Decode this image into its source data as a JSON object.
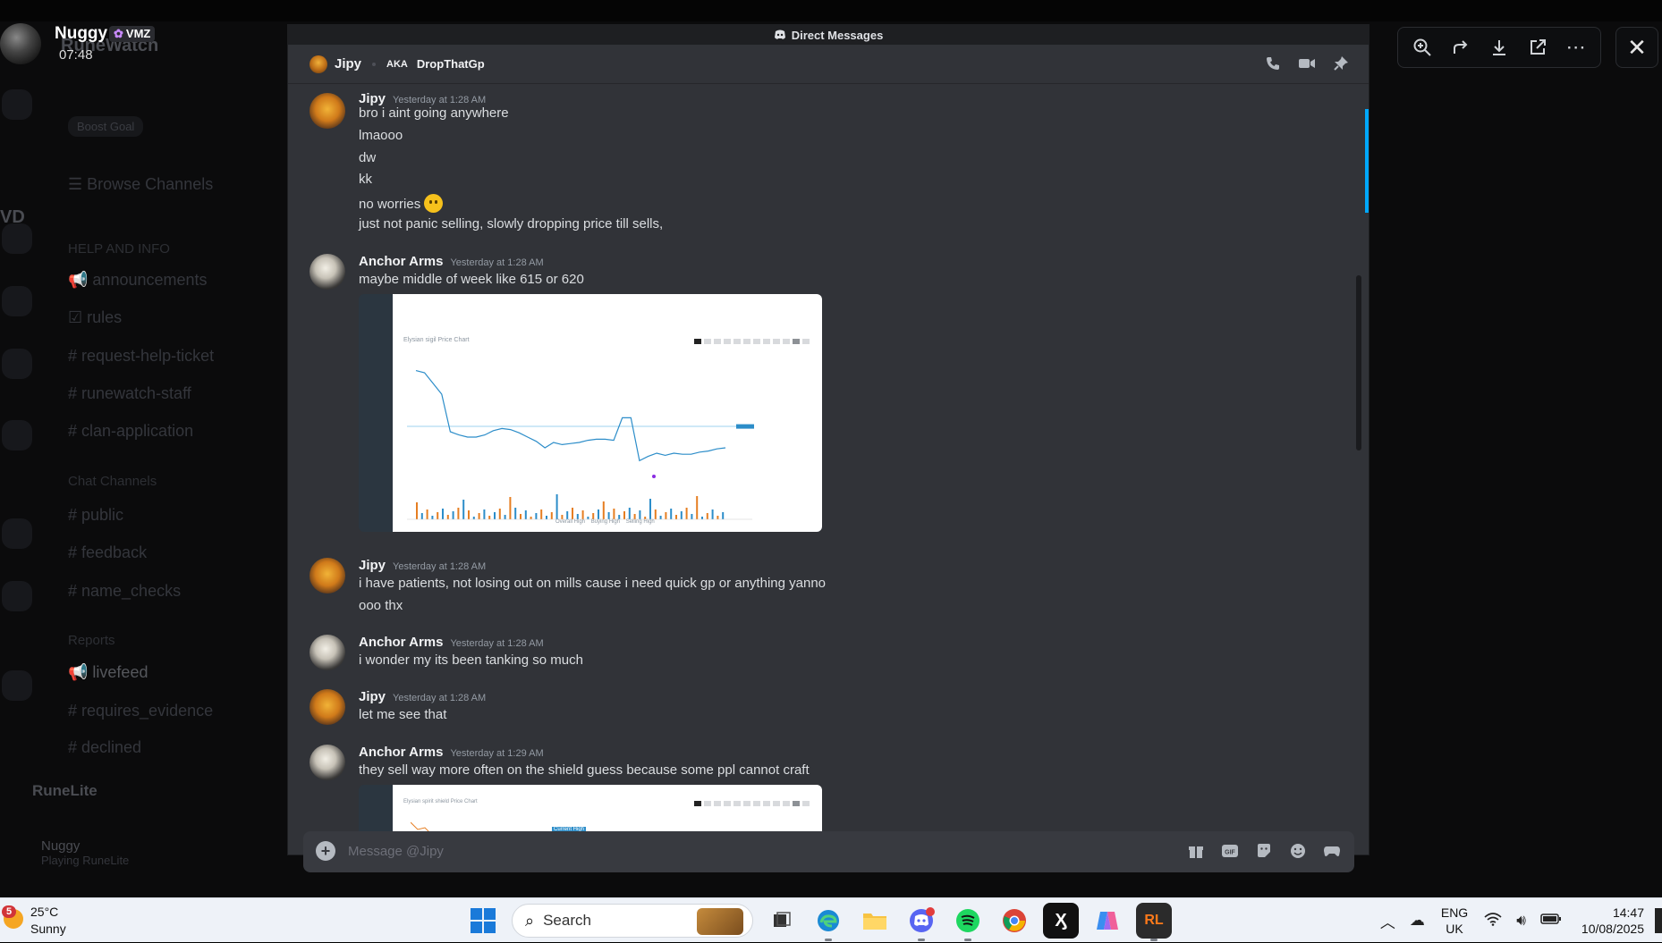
{
  "background_app": {
    "server_title": "RuneWatch",
    "boost_label": "Boost Goal",
    "browse_channels": "Browse Channels",
    "categories": [
      {
        "label": "HELP AND INFO"
      },
      {
        "label": "Chat Channels"
      },
      {
        "label": "Reports"
      }
    ],
    "channels": [
      {
        "label": "announcements"
      },
      {
        "label": "rules"
      },
      {
        "label": "request-help-ticket"
      },
      {
        "label": "runewatch-staff"
      },
      {
        "label": "clan-application"
      },
      {
        "label": "public"
      },
      {
        "label": "feedback"
      },
      {
        "label": "name_checks"
      },
      {
        "label": "livefeed"
      },
      {
        "label": "requires_evidence"
      },
      {
        "label": "declined"
      }
    ],
    "runelite_label": "RuneLite",
    "bottom_user": {
      "name": "Nuggy",
      "status": "Playing RuneLite"
    },
    "side_letters": "VD"
  },
  "viewer": {
    "user_name": "Nuggy",
    "user_tag": "VMZ",
    "time": "07:48"
  },
  "popout": {
    "title": "Direct Messages"
  },
  "dm_header": {
    "name": "Jipy",
    "aka_label": "AKA",
    "alias": "DropThatGp"
  },
  "messages": [
    {
      "author": "Jipy",
      "time": "Yesterday at 1:28 AM",
      "lines": [
        "bro i aint going anywhere",
        "lmaooo",
        "dw",
        "kk",
        "no worries",
        "just not panic selling, slowly dropping price till sells,"
      ]
    },
    {
      "author": "Anchor Arms",
      "time": "Yesterday at 1:28 AM",
      "lines": [
        "maybe middle of week like 615 or 620"
      ]
    },
    {
      "author": "Jipy",
      "time": "Yesterday at 1:28 AM",
      "lines": [
        "i have patients, not losing out on mills cause i need quick gp or anything yanno",
        "ooo thx"
      ]
    },
    {
      "author": "Anchor Arms",
      "time": "Yesterday at 1:28 AM",
      "lines": [
        "i wonder my its been tanking so much"
      ]
    },
    {
      "author": "Jipy",
      "time": "Yesterday at 1:28 AM",
      "lines": [
        "let me see that"
      ]
    },
    {
      "author": "Anchor Arms",
      "time": "Yesterday at 1:29 AM",
      "lines": [
        "they sell way more often on the shield guess because some ppl cannot craft"
      ]
    }
  ],
  "attachment1": {
    "title": "Elysian sigil Price Chart",
    "legend": [
      "Overall High",
      "Buying High",
      "Selling High"
    ],
    "price_series": [
      0.92,
      0.9,
      0.8,
      0.7,
      0.35,
      0.32,
      0.3,
      0.3,
      0.32,
      0.36,
      0.38,
      0.37,
      0.34,
      0.3,
      0.26,
      0.2,
      0.25,
      0.23,
      0.24,
      0.25,
      0.27,
      0.28,
      0.28,
      0.27,
      0.48,
      0.48,
      0.08,
      0.12,
      0.15,
      0.13,
      0.15,
      0.14,
      0.14,
      0.16,
      0.17,
      0.19,
      0.2
    ]
  },
  "attachment2": {
    "title": "Elysian spirit shield Price Chart",
    "tag": "Current High"
  },
  "composer": {
    "placeholder": "Message @Jipy"
  },
  "toolbar_icons": [
    "zoom-in-icon",
    "forward-icon",
    "download-icon",
    "open-external-icon",
    "more-icon",
    "close-icon"
  ],
  "taskbar": {
    "weather_badge": "5",
    "temperature": "25°C",
    "condition": "Sunny",
    "search_label": "Search",
    "language": "ENG",
    "region": "UK",
    "time": "14:47",
    "date": "10/08/2025"
  },
  "colors": {
    "discord_bg": "#313338",
    "link_blue": "#00a8fc",
    "chart_line": "#2c8dc9"
  }
}
